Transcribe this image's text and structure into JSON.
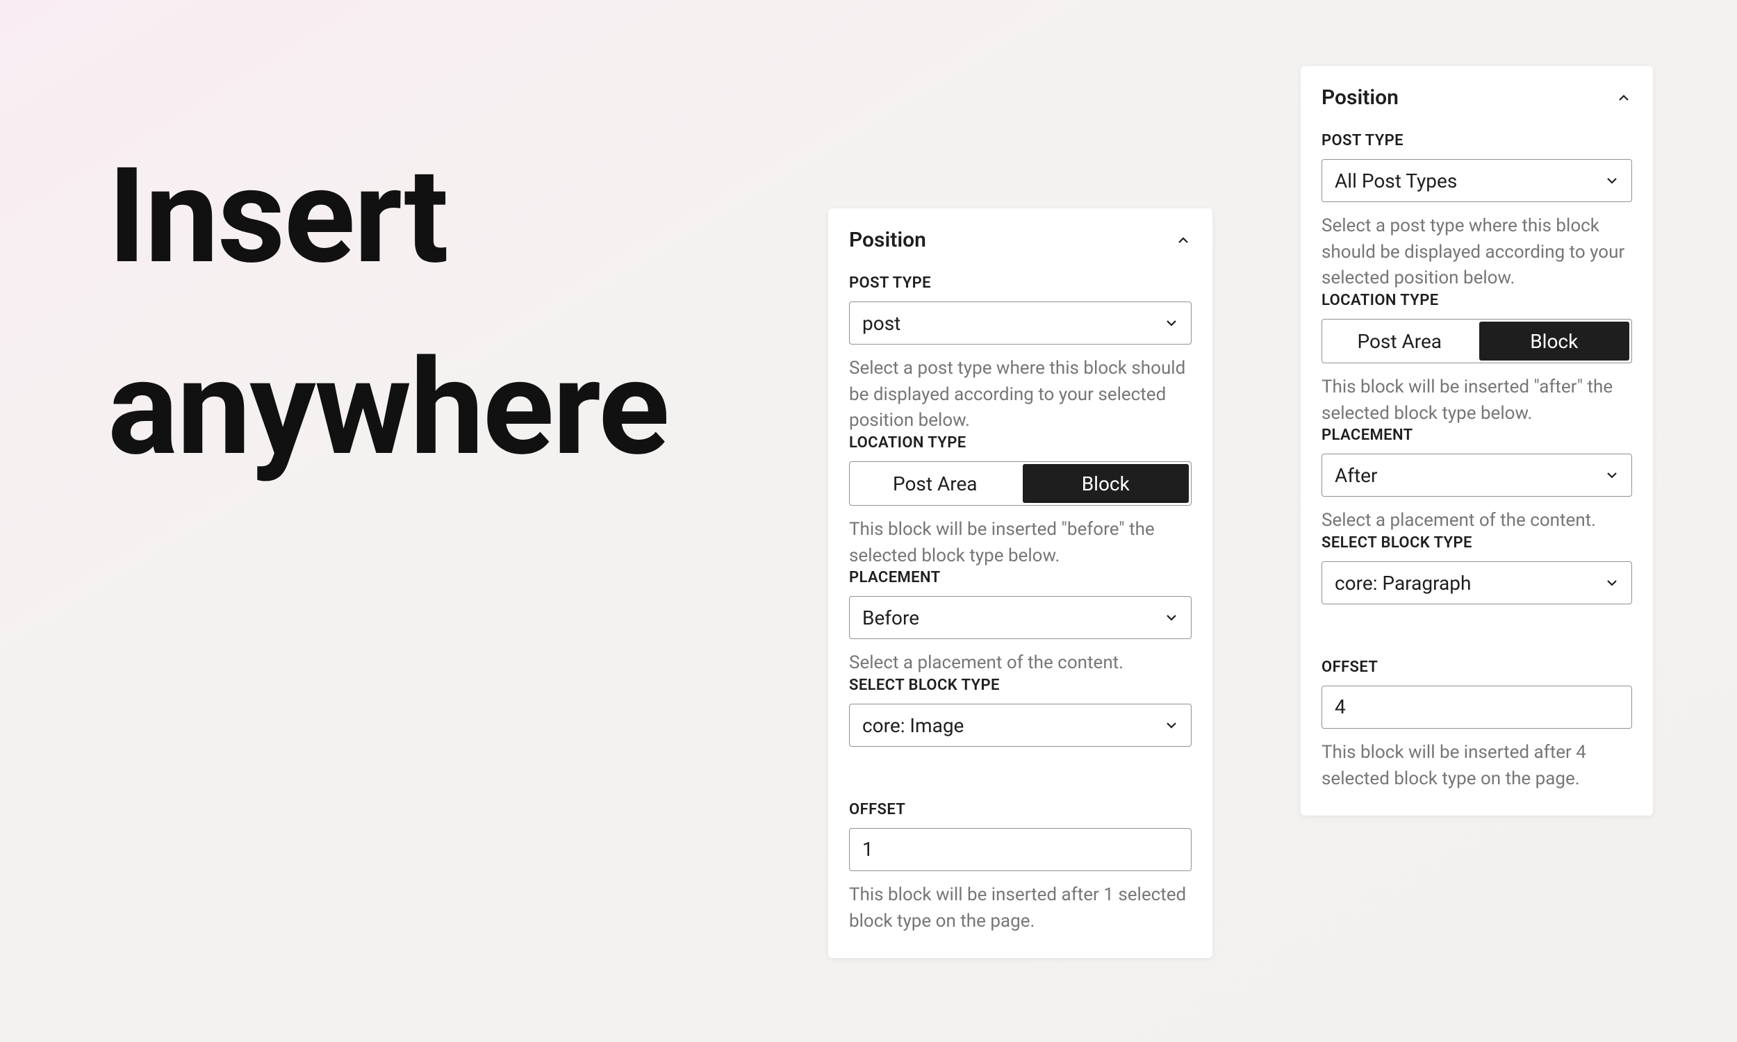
{
  "headline_line1": "Insert",
  "headline_line2": "anywhere",
  "panel1": {
    "title": "Position",
    "post_type_label": "POST TYPE",
    "post_type_value": "post",
    "post_type_help": "Select a post type where this block should be displayed according to your selected position below.",
    "location_type_label": "LOCATION TYPE",
    "location_option_a": "Post Area",
    "location_option_b": "Block",
    "location_help": "This block will be inserted \"before\" the selected block type below.",
    "placement_label": "PLACEMENT",
    "placement_value": "Before",
    "placement_help": "Select a placement of the content.",
    "block_type_label": "SELECT BLOCK TYPE",
    "block_type_value": "core: Image",
    "offset_label": "OFFSET",
    "offset_value": "1",
    "offset_help": "This block will be inserted after 1 selected block type on the page."
  },
  "panel2": {
    "title": "Position",
    "post_type_label": "POST TYPE",
    "post_type_value": "All Post Types",
    "post_type_help": "Select a post type where this block should be displayed according to your selected position below.",
    "location_type_label": "LOCATION TYPE",
    "location_option_a": "Post Area",
    "location_option_b": "Block",
    "location_help": "This block will be inserted \"after\" the selected block type below.",
    "placement_label": "PLACEMENT",
    "placement_value": "After",
    "placement_help": "Select a placement of the content.",
    "block_type_label": "SELECT BLOCK TYPE",
    "block_type_value": "core: Paragraph",
    "offset_label": "OFFSET",
    "offset_value": "4",
    "offset_help": "This block will be inserted after 4 selected block type on the page."
  }
}
